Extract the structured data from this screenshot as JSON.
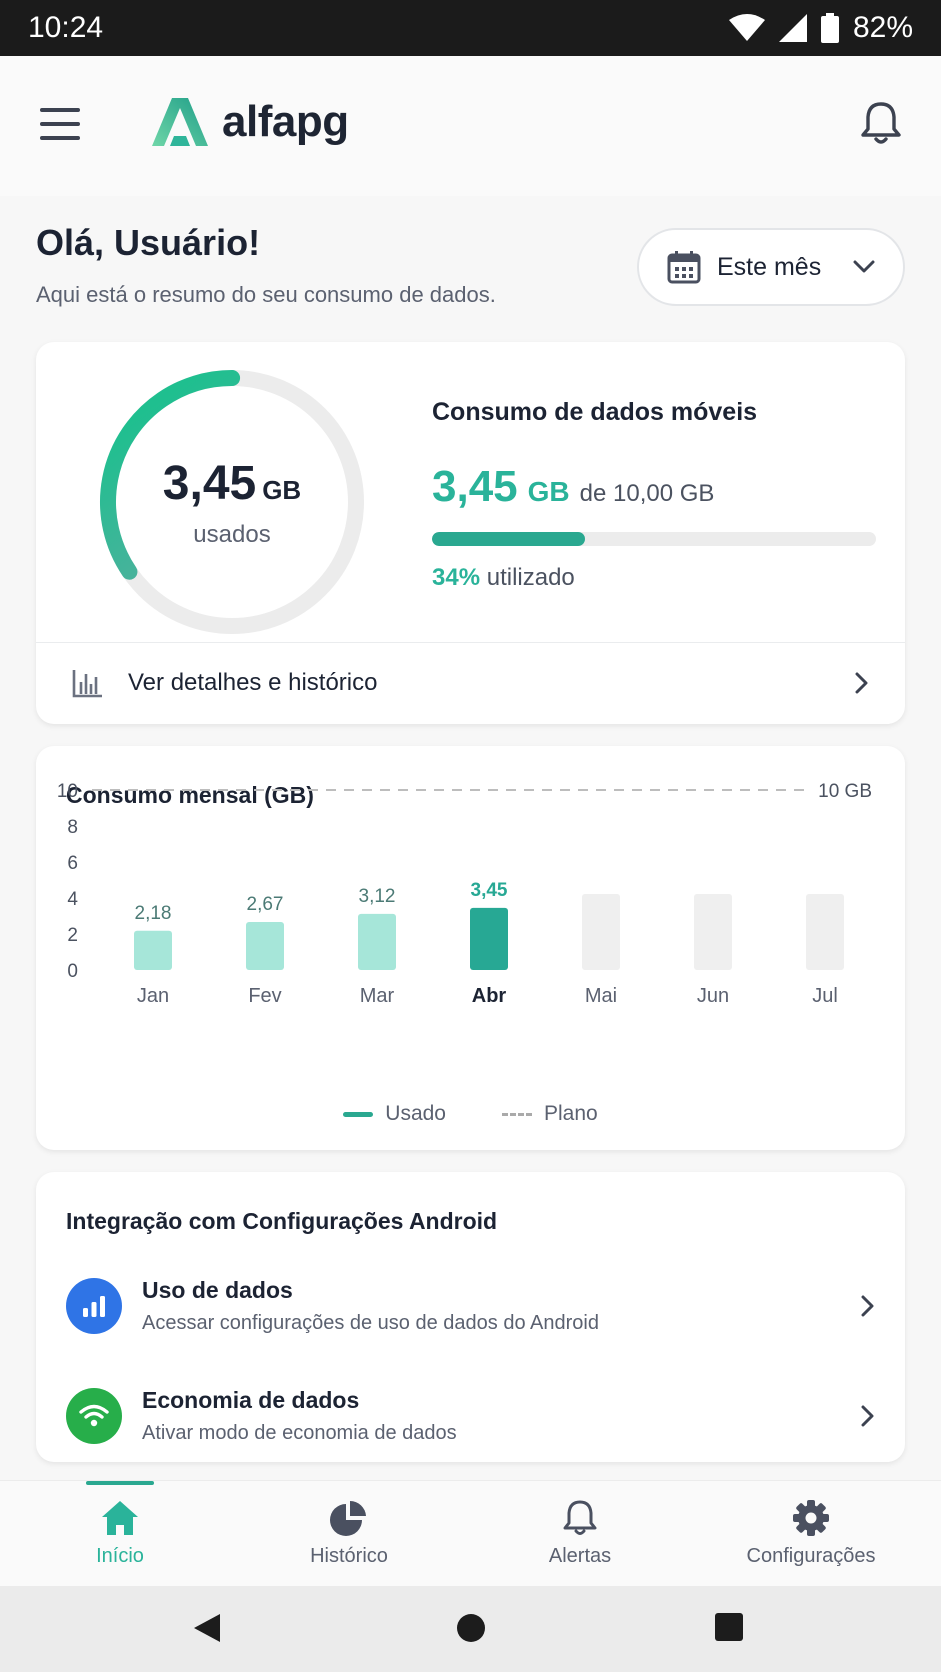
{
  "status_bar": {
    "time": "10:24",
    "battery": "82%"
  },
  "app": {
    "brand": "alfapg"
  },
  "greeting": {
    "title": "Olá, Usuário!",
    "subtitle": "Aqui está o resumo do seu consumo de dados."
  },
  "period_selector": {
    "label": "Este mês"
  },
  "usage_card": {
    "ring_value": "3,45",
    "ring_unit": "GB",
    "ring_label": "usados",
    "title": "Consumo de dados móveis",
    "used_value": "3,45",
    "used_unit": "GB",
    "of_total": "de 10,00 GB",
    "used_fraction": 0.345,
    "percent": "34%",
    "percent_label": "utilizado",
    "details_label": "Ver detalhes e histórico"
  },
  "chart_data": {
    "type": "bar",
    "title": "Consumo mensal (GB)",
    "categories": [
      "Jan",
      "Fev",
      "Mar",
      "Abr",
      "Mai",
      "Jun",
      "Jul"
    ],
    "values": [
      2.18,
      2.67,
      3.12,
      3.45,
      null,
      null,
      null
    ],
    "value_labels": [
      "2,18",
      "2,67",
      "3,12",
      "3,45",
      "",
      "",
      ""
    ],
    "highlight_index": 3,
    "y_ticks": [
      "0",
      "2",
      "4",
      "6",
      "8",
      "10"
    ],
    "ylim": [
      0,
      10
    ],
    "plan_line": {
      "value": 10,
      "label": "10 GB"
    },
    "legend": [
      {
        "name": "Usado",
        "style": "solid"
      },
      {
        "name": "Plano",
        "style": "dashed"
      }
    ],
    "legend_position": "bottom",
    "colors": {
      "used": "#a6e6d9",
      "highlight": "#27a894",
      "future": "#efefef",
      "plan": "#bdbdbd"
    }
  },
  "android_card": {
    "title": "Integração com Configurações Android",
    "items": [
      {
        "name": "Uso de dados",
        "desc": "Acessar configurações de uso de dados do Android",
        "icon": "bar-chart-icon",
        "color": "#2f74e6"
      },
      {
        "name": "Economia de dados",
        "desc": "Ativar modo de economia de dados",
        "icon": "wifi-icon",
        "color": "#27ae4a"
      }
    ]
  },
  "bottom_nav": {
    "items": [
      {
        "label": "Início",
        "icon": "home-icon",
        "active": true
      },
      {
        "label": "Histórico",
        "icon": "pie-chart-icon",
        "active": false
      },
      {
        "label": "Alertas",
        "icon": "bell-icon",
        "active": false
      },
      {
        "label": "Configurações",
        "icon": "gear-icon",
        "active": false
      }
    ]
  },
  "theme": {
    "accent": "#2ab39a",
    "accent_dark": "#27a894"
  }
}
